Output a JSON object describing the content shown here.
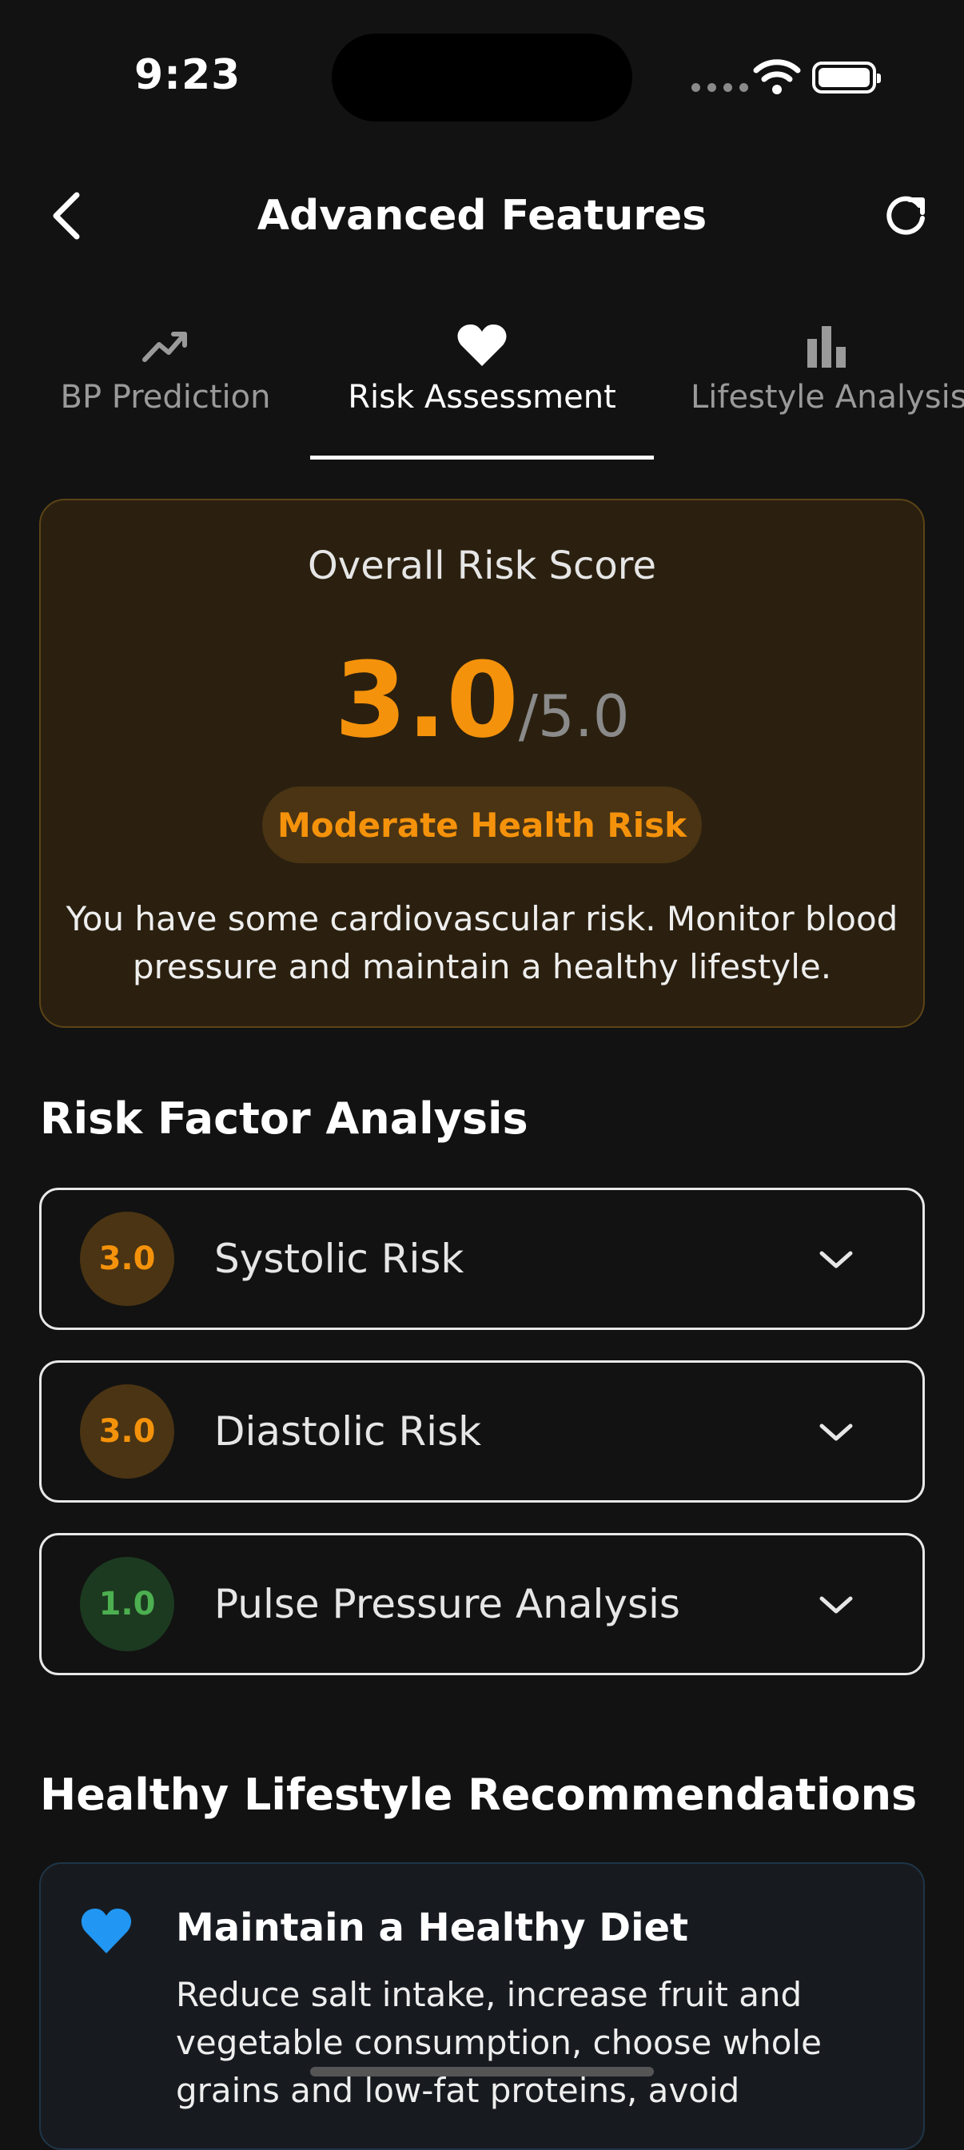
{
  "status_bar": {
    "time": "9:23"
  },
  "header": {
    "title": "Advanced Features"
  },
  "tabs": [
    {
      "label": "BP Prediction",
      "icon": "trend-up-icon"
    },
    {
      "label": "Risk Assessment",
      "icon": "heart-icon"
    },
    {
      "label": "Lifestyle Analysis",
      "icon": "bar-chart-icon"
    }
  ],
  "risk_card": {
    "label": "Overall Risk Score",
    "score": "3.0",
    "max": "/5.0",
    "level": "Moderate Health Risk",
    "description": "You have some cardiovascular risk. Monitor blood pressure and maintain a healthy lifestyle."
  },
  "factors": {
    "title": "Risk Factor Analysis",
    "items": [
      {
        "score": "3.0",
        "label": "Systolic Risk",
        "color": "#f5920b"
      },
      {
        "score": "3.0",
        "label": "Diastolic Risk",
        "color": "#f5920b"
      },
      {
        "score": "1.0",
        "label": "Pulse Pressure Analysis",
        "color": "#4caf50"
      }
    ]
  },
  "recommendations": {
    "title": "Healthy Lifestyle Recommendations",
    "items": [
      {
        "icon": "heart-icon",
        "title": "Maintain a Healthy Diet",
        "text": "Reduce salt intake, increase fruit and vegetable consumption, choose whole grains and low-fat proteins, avoid"
      }
    ]
  },
  "colors": {
    "accent": "#f5920b",
    "good": "#4caf50",
    "info": "#2196f3",
    "background": "#121212"
  }
}
